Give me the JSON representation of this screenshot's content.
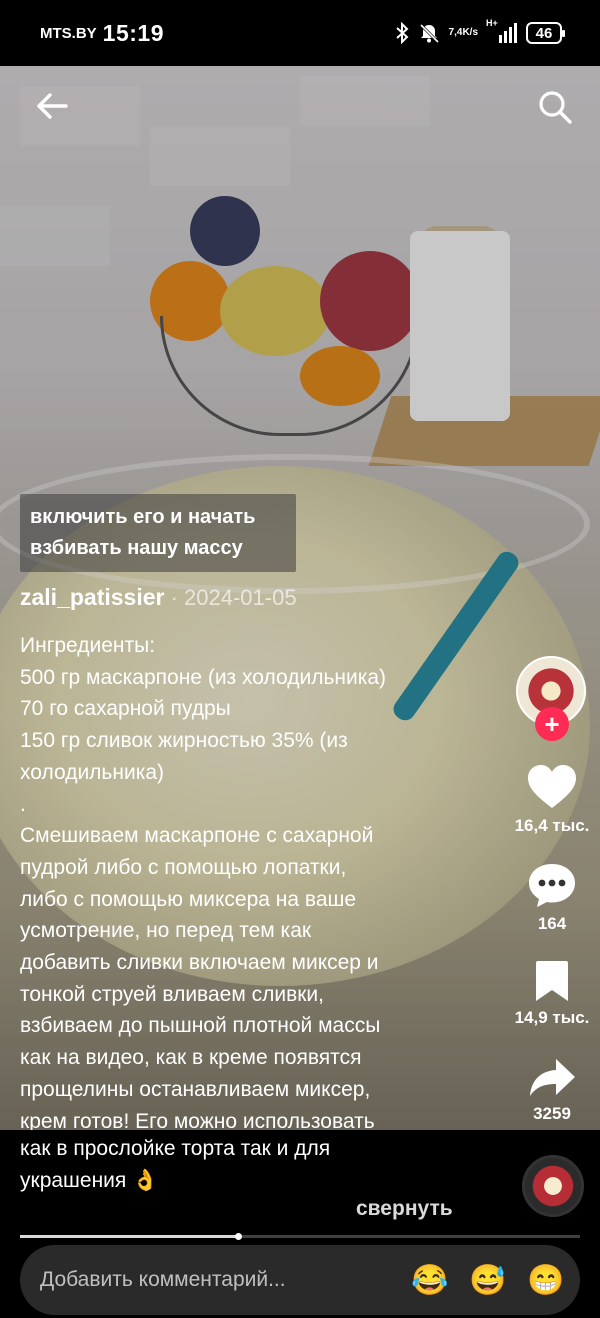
{
  "status_bar": {
    "carrier": "MTS.BY",
    "time": "15:19",
    "net_speed_value": "7,4",
    "net_speed_unit": "K/s",
    "network_type": "H+",
    "battery": "46",
    "icons": [
      "bluetooth-icon",
      "mute-icon",
      "signal-icon",
      "battery-icon"
    ]
  },
  "nav": {
    "back_icon": "arrow-left-icon",
    "search_icon": "search-icon"
  },
  "subtitle": {
    "lines": [
      "включить его и начать",
      "взбивать нашу массу"
    ]
  },
  "post": {
    "author": "zali_patissier",
    "date": " · 2024-01-05",
    "description_lines": [
      "Ингредиенты:",
      "500 гр маскарпоне (из холодильника)",
      "70 го сахарной пудры",
      "150 гр сливок жирностью 35% (из",
      "холодильника)",
      ".",
      "Смешиваем маскарпоне с сахарной",
      "пудрой либо с помощью лопатки,",
      "либо с помощью миксера на ваше",
      "усмотрение, но перед тем как",
      "добавить сливки включаем миксер и",
      "тонкой струей вливаем сливки,",
      "взбиваем до пышной плотной массы",
      "как на видео, как в креме появятся",
      "прощелины останавливаем миксер,",
      "крем готов! Его можно использовать",
      "как в прослойке торта так и для",
      "украшения 👌"
    ],
    "collapse_label": "свернуть"
  },
  "actions": {
    "follow_label": "+",
    "likes": "16,4 тыс.",
    "comments": "164",
    "saves": "14,9 тыс.",
    "shares": "3259"
  },
  "progress": {
    "fraction": 0.39
  },
  "comment_bar": {
    "placeholder": "Добавить комментарий...",
    "emojis": [
      "😂",
      "😅",
      "😁"
    ]
  },
  "colors": {
    "accent": "#fe2c55",
    "background": "#000000"
  }
}
